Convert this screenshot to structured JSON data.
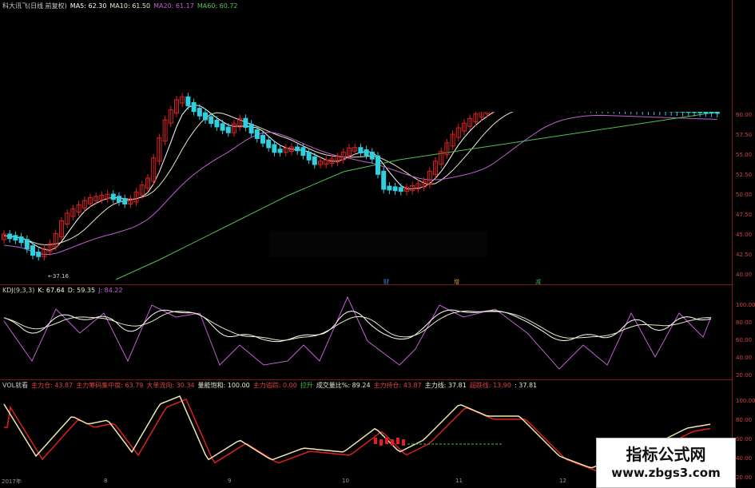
{
  "main": {
    "legend": [
      {
        "text": "科大讯飞(日线 前复权)",
        "color": "#cccccc"
      },
      {
        "text": "MA5: 62.30",
        "color": "#ffffff"
      },
      {
        "text": "MA10: 61.50",
        "color": "#e8e8c8"
      },
      {
        "text": "MA20: 61.17",
        "color": "#c060d0"
      },
      {
        "text": "MA60: 60.72",
        "color": "#50c050"
      }
    ],
    "low_label": "37.16",
    "y_ticks": [
      "60.00",
      "57.50",
      "55.00",
      "52.50",
      "50.00",
      "47.50",
      "45.00",
      "42.50",
      "40.00"
    ],
    "markers": [
      {
        "text": "财",
        "color": "#4a8ad0"
      },
      {
        "text": "增",
        "color": "#d0a030"
      },
      {
        "text": "减",
        "color": "#40b050"
      }
    ]
  },
  "kdj": {
    "legend": [
      {
        "text": "KDJ(9,3,3)",
        "color": "#cccccc"
      },
      {
        "text": "K: 67.64",
        "color": "#ffffff"
      },
      {
        "text": "D: 59.35",
        "color": "#e8e8c8"
      },
      {
        "text": "J: 84.22",
        "color": "#c060d0"
      }
    ],
    "y_ticks": [
      "100.00",
      "80.00",
      "60.00",
      "40.00",
      "20.00"
    ]
  },
  "vol": {
    "legend": [
      {
        "text": "VOL就看",
        "color": "#cccccc"
      },
      {
        "text": "主力仓: 43.87",
        "color": "#e04040"
      },
      {
        "text": "主力筹码集中度: 63.79",
        "color": "#e04040"
      },
      {
        "text": "大单流向: 30.34",
        "color": "#e04040"
      },
      {
        "text": "量能饱和: 100.00",
        "color": "#e8e8c8"
      },
      {
        "text": "主力追踪: 0.00",
        "color": "#e04040"
      },
      {
        "text": "拉升",
        "color": "#40c040"
      },
      {
        "text": "成交量比%: 89.24",
        "color": "#e8e8c8"
      },
      {
        "text": "主力持仓: 43.87",
        "color": "#e04040"
      },
      {
        "text": "主力线: 37.81",
        "color": "#e8e8c8"
      },
      {
        "text": "超跌线: 13.90",
        "color": "#e04040"
      },
      {
        "text": ": 37.81",
        "color": "#e8e8c8"
      }
    ],
    "y_ticks": [
      "100.00",
      "80.00",
      "60.00",
      "40.00",
      "20.00"
    ]
  },
  "x_labels": [
    "2017年",
    "8",
    "9",
    "10",
    "11",
    "12"
  ],
  "watermark": {
    "line1": "指标公式网",
    "line2": "www.zbgs3.com"
  },
  "colors": {
    "up": "#e02020",
    "down": "#30d0e0",
    "ma5": "#ffffff",
    "ma10": "#e8e8c8",
    "ma20": "#c060d0",
    "ma60": "#50c050",
    "bg": "#000000",
    "grid": "#7a1b1b"
  }
}
